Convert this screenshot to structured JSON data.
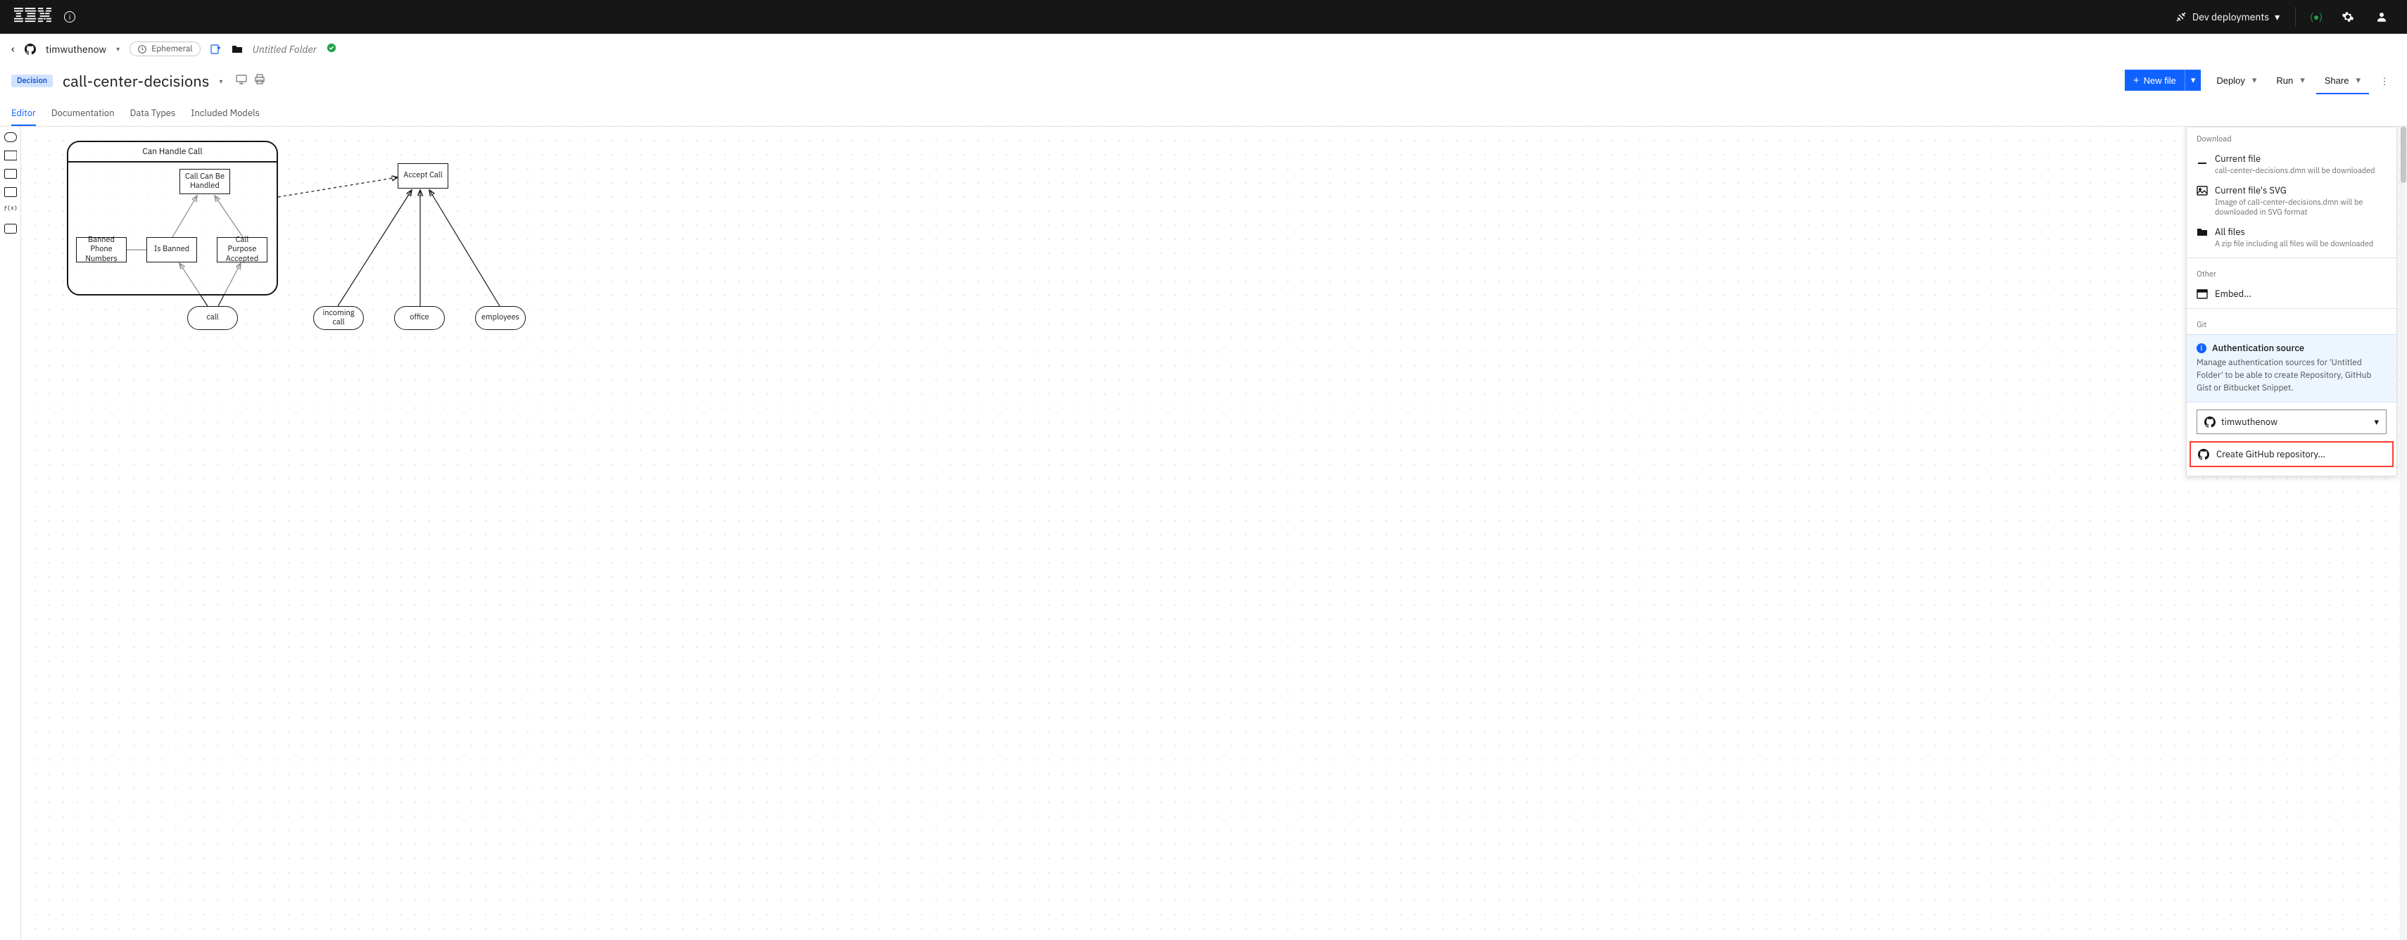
{
  "header": {
    "deploy_env": "Dev deployments"
  },
  "breadcrumb": {
    "repo": "timwuthenow",
    "mode": "Ephemeral",
    "folder": "Untitled Folder"
  },
  "titlebar": {
    "tag": "Decision",
    "title": "call-center-decisions",
    "new_file": "New file",
    "deploy": "Deploy",
    "run": "Run",
    "share": "Share"
  },
  "tabs": {
    "editor": "Editor",
    "documentation": "Documentation",
    "data_types": "Data Types",
    "included_models": "Included Models"
  },
  "diagram": {
    "container": "Can Handle Call",
    "call_can_be_handled": "Call Can Be Handled",
    "banned_phone_numbers": "Banned Phone Numbers",
    "is_banned": "Is Banned",
    "call_purpose_accepted": "Call Purpose Accepted",
    "call": "call",
    "accept_call": "Accept Call",
    "incoming_call": "incoming call",
    "office": "office",
    "employees": "employees"
  },
  "share_panel": {
    "download_label": "Download",
    "current_file": "Current file",
    "current_file_desc": "call-center-decisions.dmn will be downloaded",
    "current_svg": "Current file's SVG",
    "current_svg_desc": "Image of call-center-decisions.dmn will be downloaded in SVG format",
    "all_files": "All files",
    "all_files_desc": "A zip file including all files will be downloaded",
    "other_label": "Other",
    "embed": "Embed...",
    "git_label": "Git",
    "auth_title": "Authentication source",
    "auth_msg": "Manage authentication sources for 'Untitled Folder' to be able to create Repository, GitHub Gist or Bitbucket Snippet.",
    "auth_user": "timwuthenow",
    "create_repo": "Create GitHub repository..."
  }
}
